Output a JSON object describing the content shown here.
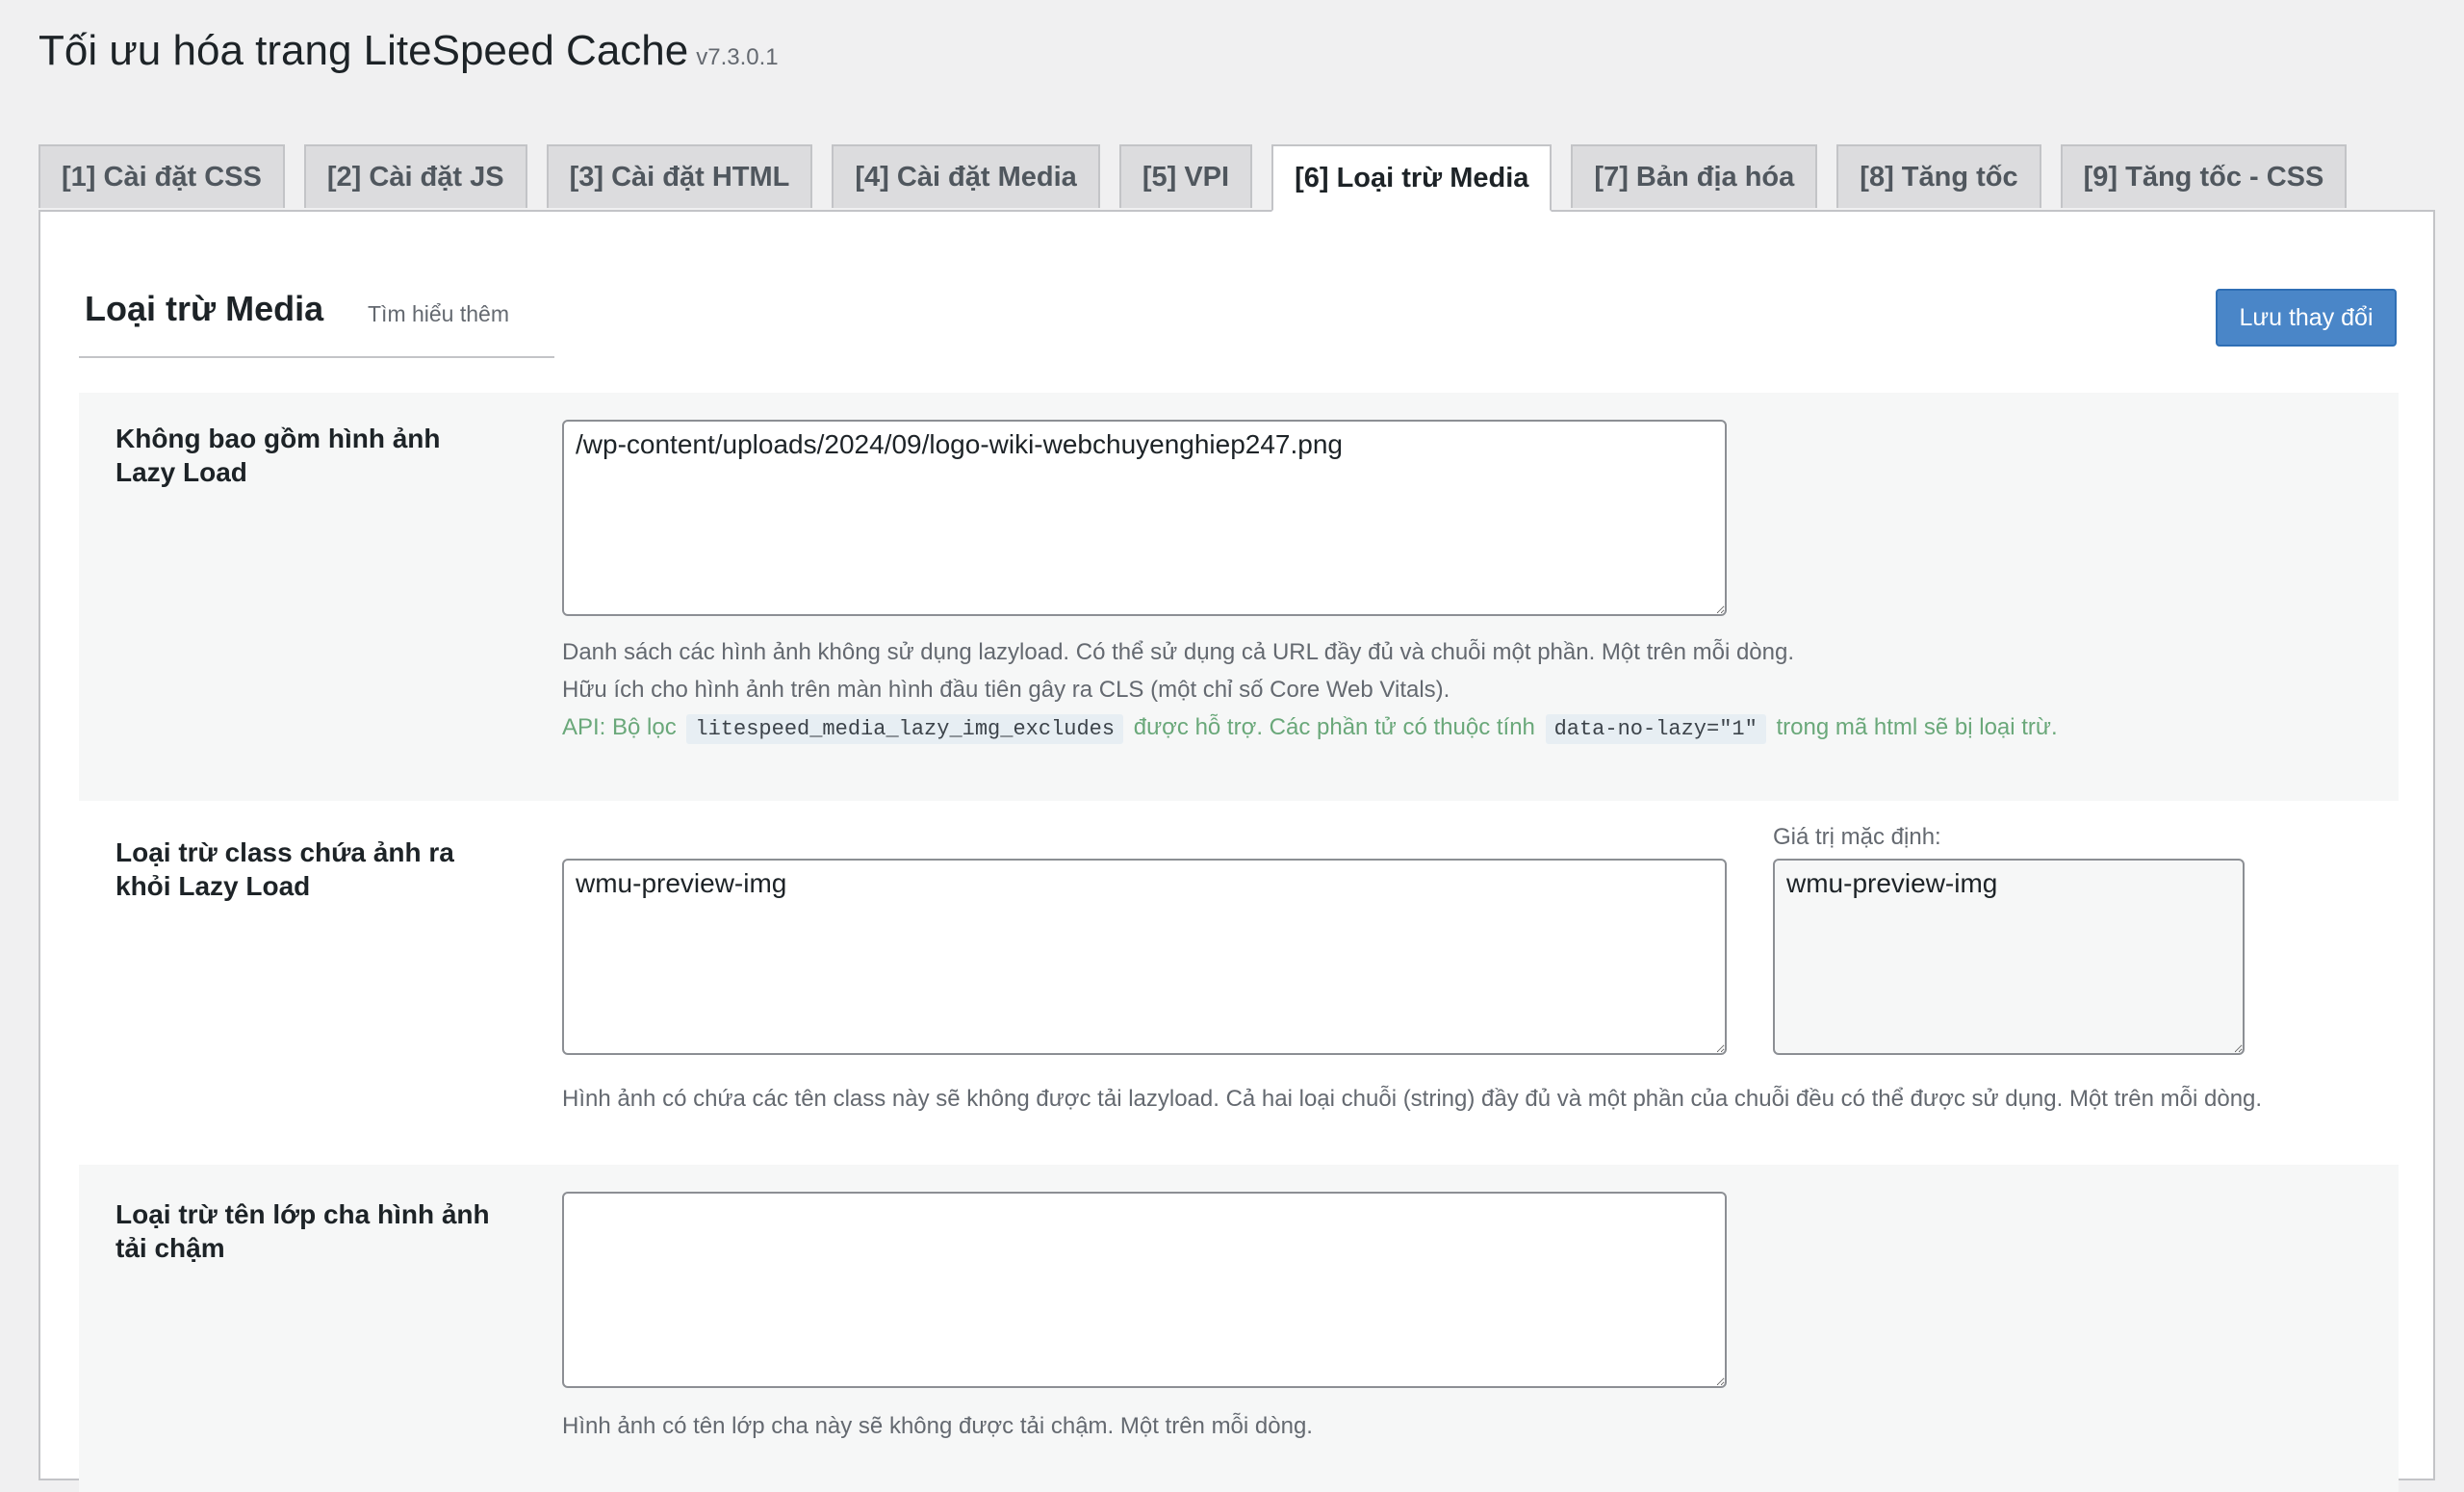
{
  "page": {
    "title": "Tối ưu hóa trang LiteSpeed Cache",
    "version": "v7.3.0.1"
  },
  "tabs": [
    {
      "label": "[1] Cài đặt CSS"
    },
    {
      "label": "[2] Cài đặt JS"
    },
    {
      "label": "[3] Cài đặt HTML"
    },
    {
      "label": "[4] Cài đặt Media"
    },
    {
      "label": "[5] VPI"
    },
    {
      "label": "[6] Loại trừ Media",
      "active": true
    },
    {
      "label": "[7] Bản địa hóa"
    },
    {
      "label": "[8] Tăng tốc"
    },
    {
      "label": "[9] Tăng tốc - CSS"
    }
  ],
  "section": {
    "title": "Loại trừ Media",
    "learn_more": "Tìm hiểu thêm",
    "save_label": "Lưu thay đổi"
  },
  "settings": {
    "lazy_img_excludes": {
      "label": "Không bao gồm hình ảnh Lazy Load",
      "value": "/wp-content/uploads/2024/09/logo-wiki-webchuyenghiep247.png",
      "desc1": "Danh sách các hình ảnh không sử dụng lazyload. Có thể sử dụng cả URL đầy đủ và chuỗi một phần. Một trên mỗi dòng.",
      "desc2": "Hữu ích cho hình ảnh trên màn hình đầu tiên gây ra CLS (một chỉ số Core Web Vitals).",
      "api_prefix": "API: Bộ lọc",
      "api_code1": "litespeed_media_lazy_img_excludes",
      "api_middle": "được hỗ trợ. Các phần tử có thuộc tính",
      "api_code2": "data-no-lazy=\"1\"",
      "api_suffix": "trong mã html sẽ bị loại trừ."
    },
    "lazy_cls_excludes": {
      "label": "Loại trừ class chứa ảnh ra khỏi Lazy Load",
      "value": "wmu-preview-img",
      "default_label": "Giá trị mặc định:",
      "default_value": "wmu-preview-img",
      "desc": "Hình ảnh có chứa các tên class này sẽ không được tải lazyload. Cả hai loại chuỗi (string) đầy đủ và một phần của chuỗi đều có thể được sử dụng. Một trên mỗi dòng."
    },
    "lazy_parent_cls_excludes": {
      "label": "Loại trừ tên lớp cha hình ảnh tải chậm",
      "value": "",
      "desc": "Hình ảnh có tên lớp cha này sẽ không được tải chậm. Một trên mỗi dòng."
    }
  }
}
